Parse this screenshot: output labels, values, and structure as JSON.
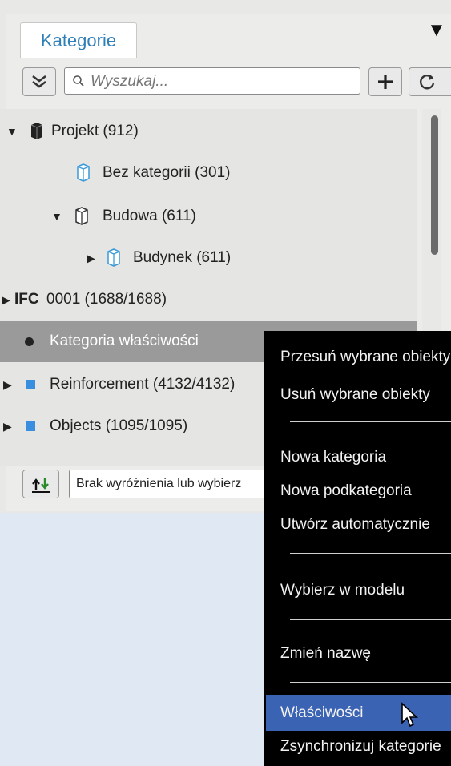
{
  "tabs": {
    "active": "Kategorie",
    "dropdown_icon": "triangle-down-icon"
  },
  "toolbar": {
    "collapse_icon": "collapse-all-icon",
    "search_placeholder": "Wyszukaj...",
    "add_icon": "plus-icon",
    "refresh_icon": "refresh-icon"
  },
  "tree": {
    "items": [
      {
        "label": "Projekt (912)",
        "icon": "cube-dark-icon",
        "expanded": true
      },
      {
        "label": "Bez kategorii (301)",
        "icon": "cube-outline-blue-icon"
      },
      {
        "label": "Budowa (611)",
        "icon": "cube-outline-icon",
        "expanded": true
      },
      {
        "label": "Budynek (611)",
        "icon": "cube-outline-blue-icon",
        "expanded": false
      },
      {
        "label_prefix": "IFC",
        "label": "0001 (1688/1688)",
        "expanded": false
      },
      {
        "label": "Kategoria właściwości",
        "selected": true
      },
      {
        "label": "Reinforcement (4132/4132)",
        "icon": "blue-square-icon",
        "expanded": false
      },
      {
        "label": "Objects (1095/1095)",
        "icon": "blue-square-icon",
        "expanded": false
      }
    ]
  },
  "bottom": {
    "highlight_select": "Brak wyróżnienia lub wybierz"
  },
  "context_menu": {
    "items": [
      "Przesuń wybrane obiekty",
      "Usuń wybrane obiekty",
      "Nowa kategoria",
      "Nowa podkategoria",
      "Utwórz automatycznie",
      "Wybierz w modelu",
      "Zmień nazwę",
      "Właściwości",
      "Zsynchronizuj kategorie"
    ],
    "highlighted": "Właściwości",
    "highlight_color": "#3b63b4"
  },
  "colors": {
    "accent": "#2f7fb8",
    "selected_row": "#9a9a9a",
    "menu_bg": "#000000"
  }
}
